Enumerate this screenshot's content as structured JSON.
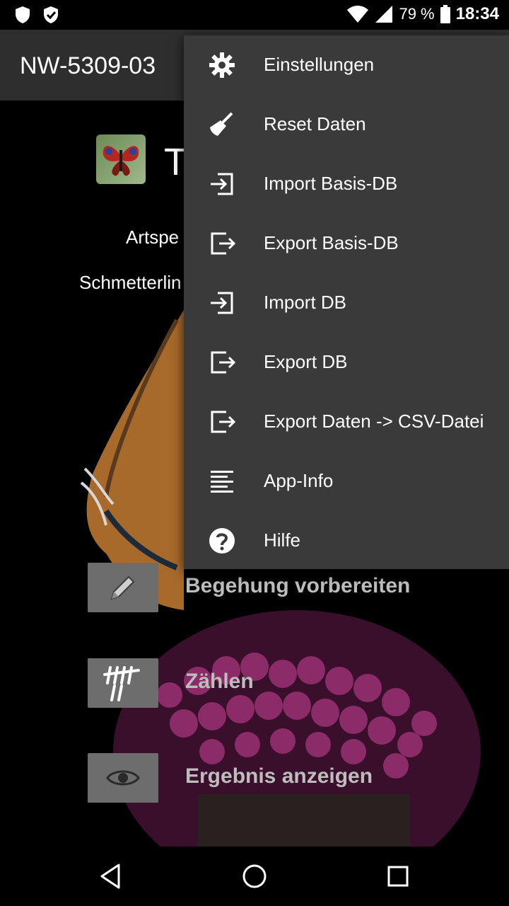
{
  "status_bar": {
    "battery_percent": "79 %",
    "time": "18:34",
    "left_icons": [
      "shield-icon",
      "shield-check-icon"
    ],
    "right_icons": [
      "wifi-icon",
      "signal-icon"
    ]
  },
  "app_bar": {
    "title": "NW-5309-03"
  },
  "main": {
    "app_name_partial": "T",
    "subtitle_1": "Artspe",
    "subtitle_2": "Schmetterlin",
    "actions": [
      {
        "label": "Begehung vorbereiten",
        "icon": "pencil-icon"
      },
      {
        "label": "Zählen",
        "icon": "tally-icon"
      },
      {
        "label": "Ergebnis anzeigen",
        "icon": "eye-icon"
      }
    ]
  },
  "menu": {
    "items": [
      {
        "label": "Einstellungen",
        "icon": "gear-icon"
      },
      {
        "label": "Reset Daten",
        "icon": "broom-icon"
      },
      {
        "label": "Import Basis-DB",
        "icon": "import-icon"
      },
      {
        "label": "Export Basis-DB",
        "icon": "export-icon"
      },
      {
        "label": "Import DB",
        "icon": "import-icon"
      },
      {
        "label": "Export DB",
        "icon": "export-icon"
      },
      {
        "label": "Export Daten -> CSV-Datei",
        "icon": "export-icon"
      },
      {
        "label": "App-Info",
        "icon": "text-lines-icon"
      },
      {
        "label": "Hilfe",
        "icon": "help-icon"
      }
    ]
  },
  "nav_bar": {
    "icons": [
      "back-icon",
      "home-icon",
      "recents-icon"
    ]
  }
}
